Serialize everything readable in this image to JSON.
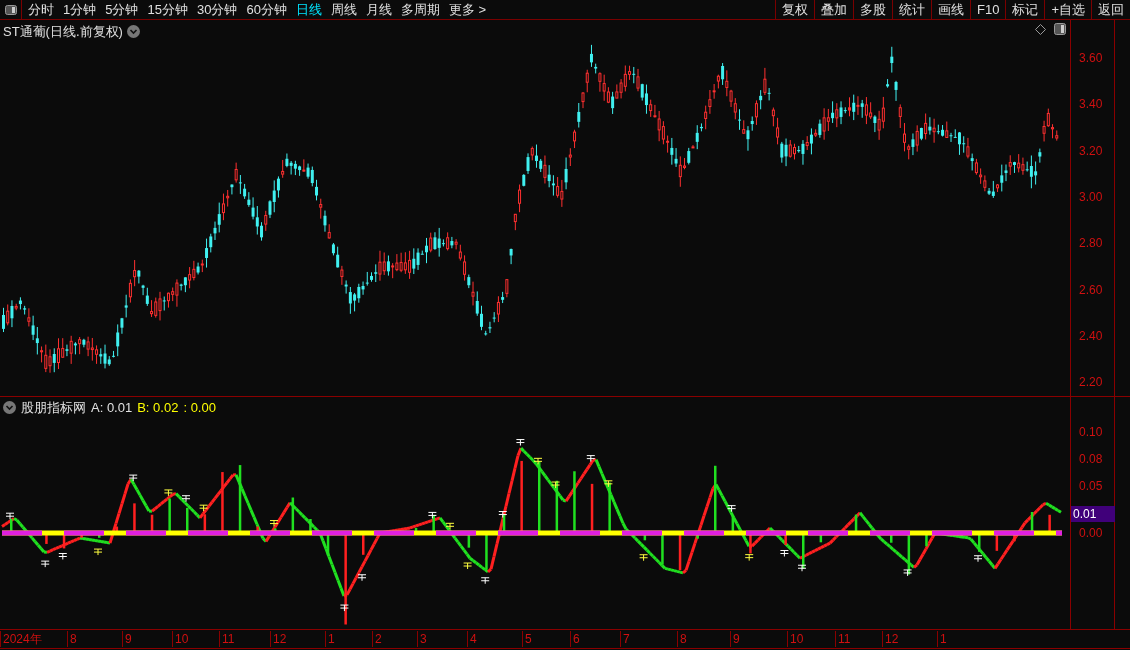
{
  "toolbar": {
    "periods": [
      {
        "label": "分时",
        "selected": false
      },
      {
        "label": "1分钟",
        "selected": false
      },
      {
        "label": "5分钟",
        "selected": false
      },
      {
        "label": "15分钟",
        "selected": false
      },
      {
        "label": "30分钟",
        "selected": false
      },
      {
        "label": "60分钟",
        "selected": false
      },
      {
        "label": "日线",
        "selected": true
      },
      {
        "label": "周线",
        "selected": false
      },
      {
        "label": "月线",
        "selected": false
      },
      {
        "label": "多周期",
        "selected": false
      }
    ],
    "more": {
      "label": "更多",
      "arrow": ">"
    },
    "actions": [
      "复权",
      "叠加",
      "多股",
      "统计",
      "画线",
      "F10",
      "标记",
      "+自选",
      "返回"
    ]
  },
  "main_chart": {
    "title": "ST通葡(日线.前复权)",
    "y_ticks": [
      "3.60",
      "3.40",
      "3.20",
      "3.00",
      "2.80",
      "2.60",
      "2.40",
      "2.20"
    ]
  },
  "indicator": {
    "name": "股朋指标网",
    "a_value": "A: 0.01",
    "b_value": "B: 0.02",
    "c_value": ": 0.00",
    "y_ticks": [
      "0.10",
      "0.08",
      "0.05",
      "0.00"
    ],
    "current_tag": "0.01"
  },
  "time_axis": [
    "2024年",
    "8",
    "9",
    "10",
    "11",
    "12",
    "1",
    "2",
    "3",
    "4",
    "5",
    "6",
    "7",
    "8",
    "9",
    "10",
    "11",
    "12",
    "1"
  ]
}
